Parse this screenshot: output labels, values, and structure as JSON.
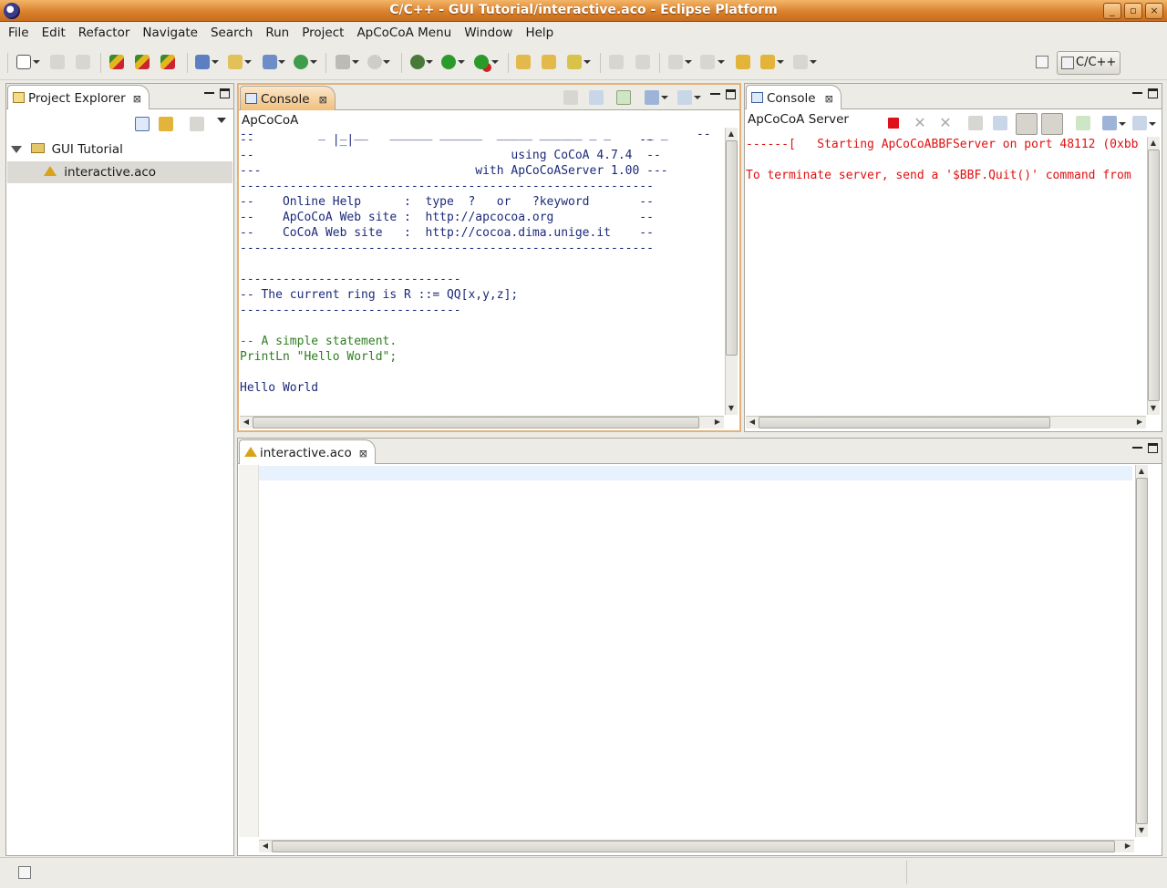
{
  "window": {
    "title": "C/C++ - GUI Tutorial/interactive.aco - Eclipse Platform",
    "min": "_",
    "restore": "▫",
    "close": "×"
  },
  "menubar": [
    "File",
    "Edit",
    "Refactor",
    "Navigate",
    "Search",
    "Run",
    "Project",
    "ApCoCoA Menu",
    "Window",
    "Help"
  ],
  "toolbar": {
    "perspective_label": "C/C++"
  },
  "project_explorer": {
    "tab_label": "Project Explorer",
    "close": "⊠",
    "tree": [
      {
        "label": "GUI Tutorial",
        "expanded": true
      },
      {
        "label": "interactive.aco",
        "selected": true
      }
    ]
  },
  "console_main": {
    "tab_label": "Console",
    "close": "⊠",
    "name": "ApCoCoA",
    "lines_blue": [
      "--           |_|                                        --",
      "--                                    using CoCoA 4.7.4  --",
      "---                              with ApCoCoAServer 1.00 ---",
      "----------------------------------------------------------",
      "--    Online Help      :  type  ?   or   ?keyword       --",
      "--    ApCoCoA Web site :  http://apcocoa.org            --",
      "--    CoCoA Web site   :  http://cocoa.dima.unige.it    --",
      "----------------------------------------------------------",
      "",
      "-------------------------------",
      "-- The current ring is R ::= QQ[x,y,z];",
      "-------------------------------",
      ""
    ],
    "lines_green": [
      "-- A simple statement.",
      "PrintLn \"Hello World\";"
    ],
    "lines_output": [
      "",
      "Hello World"
    ]
  },
  "console_server": {
    "tab_label": "Console",
    "close": "⊠",
    "name": "ApCoCoA Server",
    "lines": [
      "------[   Starting ApCoCoABBFServer on port 48112 (0xbb",
      "",
      "To terminate server, send a '$BBF.Quit()' command from"
    ]
  },
  "editor": {
    "tab_label": "interactive.aco",
    "close": "⊠"
  },
  "colors": {
    "title_orange": "#d9822d",
    "console_blue": "#1c2a7a",
    "comment_green": "#2e7d1f",
    "server_red": "#e01010",
    "active_tab": "#f3c98b"
  }
}
